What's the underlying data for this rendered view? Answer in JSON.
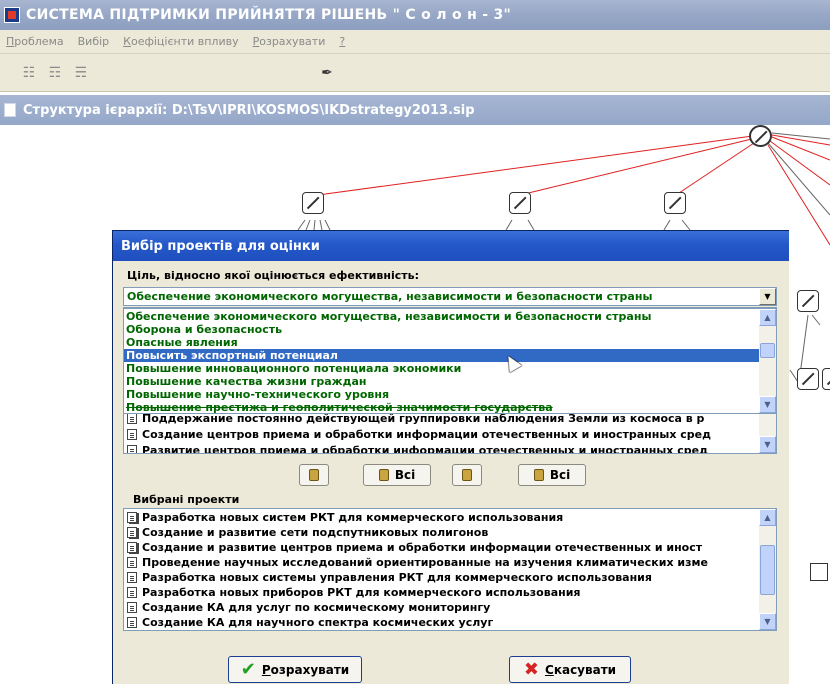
{
  "window": {
    "title": "СИСТЕМА ПІДТРИМКИ ПРИЙНЯТТЯ РІШЕНЬ \" С о л о н - 3\""
  },
  "menu": [
    {
      "label": "Проблема",
      "underline": "П",
      "rest": "роблема"
    },
    {
      "label": "Вибір",
      "underline": "",
      "rest": "Вибір"
    },
    {
      "label": "Коефіцієнти впливу",
      "underline": "К",
      "rest": "оефіцієнти впливу"
    },
    {
      "label": "Розрахувати",
      "underline": "Р",
      "rest": "озрахувати"
    },
    {
      "label": "?",
      "underline": "?",
      "rest": ""
    }
  ],
  "toolbar": {
    "icons": [
      "tree-icon",
      "tree-alt-icon",
      "tree-check-icon",
      "edit-icon"
    ]
  },
  "inner_window": {
    "title": "Структура ієрархії: D:\\TsV\\IPRI\\KOSMOS\\IKDstrategy2013.sip"
  },
  "dialog": {
    "title": "Вибір проектів для оцінки",
    "goal_label": "Ціль, відносно якої оцінюється ефективність:",
    "goal_selected": "Обеспечение экономического могущества, независимости и безопасности страны",
    "dropdown_options": [
      "Обеспечение экономического могущества, независимости и безопасности страны",
      "Оборона и безопасность",
      "Опасные явления",
      "Повысить экспортный потенциал",
      "Повышение инновационного потенциала экономики",
      "Повышение качества жизни граждан",
      "Повышение научно-технического уровня",
      "Повышение престижа и геополитической значимости государства"
    ],
    "dropdown_selected_index": 3,
    "available_projects": [
      "Поддержание постоянно действующей группировки наблюдения Земли из космоса в р",
      "Создание центров приема и обработки информации отечественных и иностранных сред",
      "Развитие центров приема и обработки информации отечественных и иностранных сред"
    ],
    "buttons": {
      "add_one": "",
      "add_all": "Всі",
      "remove_one": "",
      "remove_all": "Всі"
    },
    "selected_label": "Вибрані проекти",
    "selected_projects": [
      {
        "text": "Разработка новых систем РКТ для коммерческого использования",
        "multi": true
      },
      {
        "text": "Создание и развитие сети подспутниковых полигонов",
        "multi": true
      },
      {
        "text": "Создание и развитие центров приема и обработки информации отечественных и иност",
        "multi": true
      },
      {
        "text": "Проведение научных исследований ориентированные на изучения климатических изме",
        "multi": false
      },
      {
        "text": "Разработка новых системы управления РКТ для коммерческого использования",
        "multi": false
      },
      {
        "text": "Разработка новых приборов РКТ для коммерческого использования",
        "multi": false
      },
      {
        "text": "Создание КА для услуг по космическому мониторингу",
        "multi": false
      },
      {
        "text": "Создание КА для научного спектра космических услуг",
        "multi": false
      }
    ],
    "calculate_button": {
      "underline": "Р",
      "rest": "озрахувати"
    },
    "cancel_button": {
      "underline": "С",
      "rest": "касувати"
    }
  },
  "colors": {
    "goal_text": "#006600",
    "selection": "#316ac5",
    "edge_red": "#e02020",
    "edge_gray": "#666666",
    "dialog_title": "#2458c9"
  }
}
